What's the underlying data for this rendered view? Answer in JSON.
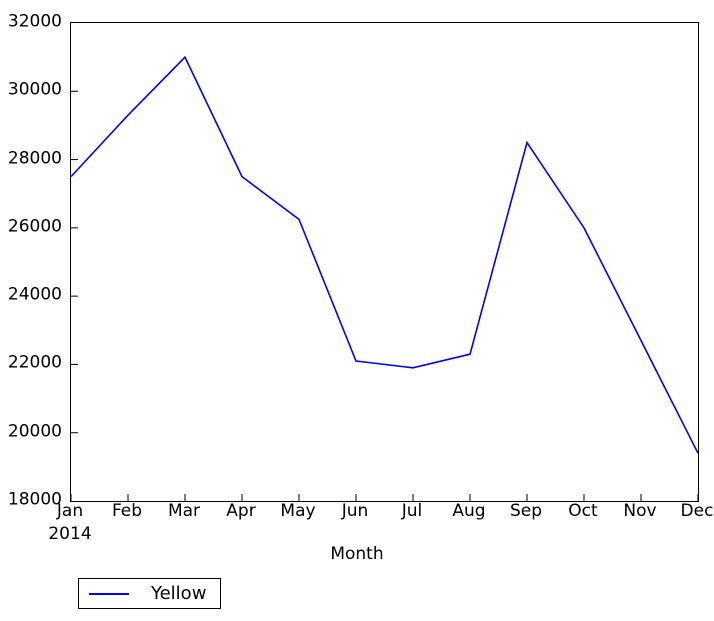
{
  "chart_data": {
    "type": "line",
    "title": "",
    "xlabel": "Month",
    "ylabel": "",
    "categories": [
      "Jan",
      "Feb",
      "Mar",
      "Apr",
      "May",
      "Jun",
      "Jul",
      "Aug",
      "Sep",
      "Oct",
      "Nov",
      "Dec"
    ],
    "x_sublabels": [
      "2014",
      "",
      "",
      "",
      "",
      "",
      "",
      "",
      "",
      "",
      "",
      ""
    ],
    "series": [
      {
        "name": "Yellow",
        "color": "#0000ff",
        "values": [
          27500,
          29300,
          31000,
          27500,
          26250,
          22100,
          21900,
          22300,
          28500,
          26000,
          22700,
          19400
        ]
      }
    ],
    "ylim": [
      18000,
      32000
    ],
    "yticks": [
      18000,
      20000,
      22000,
      24000,
      26000,
      28000,
      30000,
      32000
    ],
    "ytick_labels": [
      "18000",
      "20000",
      "22000",
      "24000",
      "26000",
      "28000",
      "30000",
      "32000"
    ],
    "grid": false,
    "legend_position": "below-axes-left",
    "legend_entries": [
      "Yellow"
    ]
  },
  "axis": {
    "xlabel": "Month",
    "year_label": "2014"
  },
  "legend": {
    "items": [
      {
        "label": "Yellow",
        "color": "#0000ff"
      }
    ]
  }
}
